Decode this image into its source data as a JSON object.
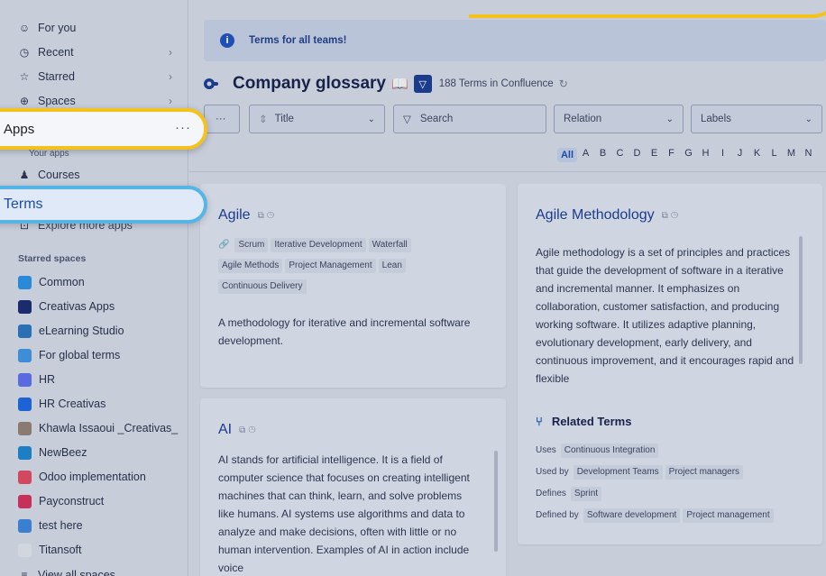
{
  "sidebar": {
    "nav": [
      {
        "label": "For you",
        "icon": "for-you-icon"
      },
      {
        "label": "Recent",
        "icon": "clock-icon"
      },
      {
        "label": "Starred",
        "icon": "star-icon"
      },
      {
        "label": "Spaces",
        "icon": "globe-icon"
      }
    ],
    "apps_label": "Apps",
    "apps_more": "···",
    "your_apps_label": "Your apps",
    "courses_label": "Courses",
    "terms_label": "Terms",
    "explore_label": "Explore more apps",
    "starred_spaces_label": "Starred spaces",
    "spaces": [
      {
        "label": "Common",
        "color": "#2a8ad8"
      },
      {
        "label": "Creativas Apps",
        "color": "#1b2b6e"
      },
      {
        "label": "eLearning Studio",
        "color": "#2b6fb5"
      },
      {
        "label": "For global terms",
        "color": "#3d8ed6"
      },
      {
        "label": "HR",
        "color": "#5a6ae0"
      },
      {
        "label": "HR Creativas",
        "color": "#1e63d6"
      },
      {
        "label": "Khawla Issaoui _Creativas_",
        "color": "#8a7a72"
      },
      {
        "label": "NewBeez",
        "color": "#1d7ec4"
      },
      {
        "label": "Odoo implementation",
        "color": "#d2485e"
      },
      {
        "label": "Payconstruct",
        "color": "#c6305b"
      },
      {
        "label": "test here",
        "color": "#3a7fd0"
      },
      {
        "label": "Titansoft",
        "color": "#d2d6de"
      }
    ],
    "view_all": "View all spaces"
  },
  "banner": {
    "text": "Terms for all teams!"
  },
  "header": {
    "title": "Company glossary",
    "count": "188 Terms in Confluence"
  },
  "filters": {
    "more": "···",
    "title": "Title",
    "search": "Search",
    "relation": "Relation",
    "labels": "Labels"
  },
  "alphabet": [
    "All",
    "A",
    "B",
    "C",
    "D",
    "E",
    "F",
    "G",
    "H",
    "I",
    "J",
    "K",
    "L",
    "M",
    "N"
  ],
  "cards": {
    "agile": {
      "title": "Agile",
      "tags_row1": [
        "Scrum",
        "Iterative Development",
        "Waterfall"
      ],
      "tags_row2": [
        "Agile Methods",
        "Project Management",
        "Lean"
      ],
      "tags_row3": [
        "Continuous Delivery"
      ],
      "desc": "A methodology for iterative and incremental software development."
    },
    "ai": {
      "title": "AI",
      "desc": "AI stands for artificial intelligence. It is a field of computer science that focuses on creating intelligent machines that can think, learn, and solve problems like humans. AI systems use algorithms and data to analyze and make decisions, often with little or no human intervention. Examples of AI in action include voice"
    },
    "agile_methodology": {
      "title": "Agile Methodology",
      "desc": "Agile methodology is a set of principles and practices that guide the development of software in a iterative and incremental manner. It emphasizes on collaboration, customer satisfaction, and producing working software. It utilizes adaptive planning, evolutionary development, early delivery, and continuous improvement, and it encourages rapid and flexible",
      "related_title": "Related Terms",
      "relations": [
        {
          "kind": "Uses",
          "terms": [
            "Continuous Integration"
          ]
        },
        {
          "kind": "Used by",
          "terms": [
            "Development Teams",
            "Project managers"
          ]
        },
        {
          "kind": "Defines",
          "terms": [
            "Sprint"
          ]
        },
        {
          "kind": "Defined by",
          "terms": [
            "Software development",
            "Project management"
          ]
        }
      ]
    }
  }
}
